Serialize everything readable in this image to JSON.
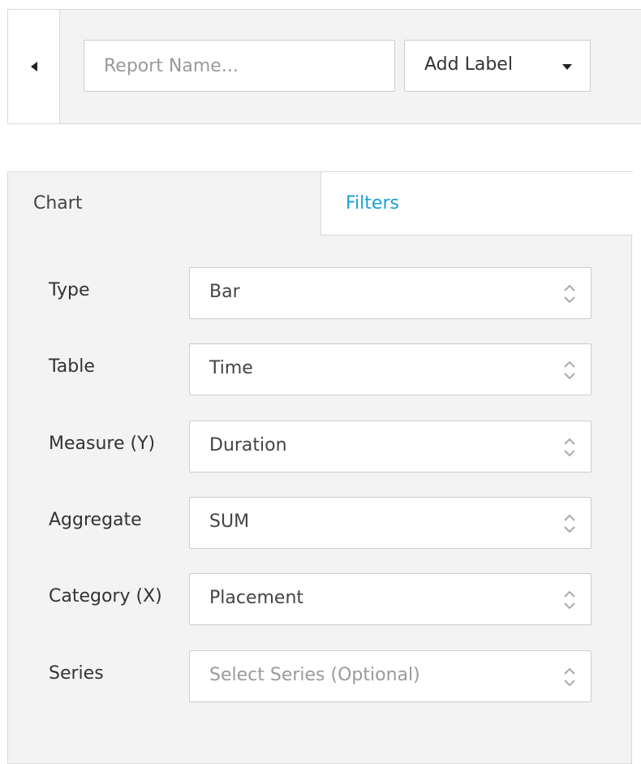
{
  "toolbar": {
    "back_icon": "caret-left-icon",
    "report_name_placeholder": "Report Name...",
    "report_name_value": "",
    "add_label": "Add Label",
    "add_label_icon": "caret-down-icon"
  },
  "tabs": {
    "chart": "Chart",
    "filters": "Filters",
    "active": "Chart",
    "filters_color": "#1a9fd6"
  },
  "form": {
    "type": {
      "label": "Type",
      "value": "Bar"
    },
    "table": {
      "label": "Table",
      "value": "Time"
    },
    "measure": {
      "label": "Measure (Y)",
      "value": "Duration"
    },
    "aggregate": {
      "label": "Aggregate",
      "value": "SUM"
    },
    "category": {
      "label": "Category (X)",
      "value": "Placement"
    },
    "series": {
      "label": "Series",
      "value": "",
      "placeholder": "Select Series (Optional)"
    }
  },
  "select_icon": "up-down-chevron-icon"
}
